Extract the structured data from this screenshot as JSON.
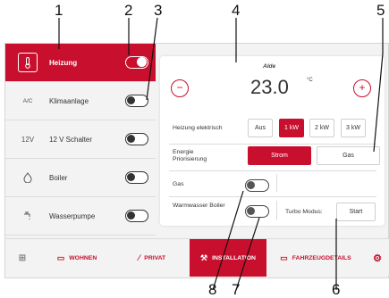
{
  "sidebar": {
    "items": [
      {
        "label": "Heizung",
        "icon": "thermometer-icon",
        "glyph": "🌡",
        "on": true
      },
      {
        "label": "Klimaanlage",
        "icon": "ac-icon",
        "glyph": "A/C",
        "on": false
      },
      {
        "label": "12 V Schalter",
        "icon": "12v-icon",
        "glyph": "12V",
        "on": false
      },
      {
        "label": "Boiler",
        "icon": "flame-icon",
        "glyph": "♨",
        "on": false
      },
      {
        "label": "Wasserpumpe",
        "icon": "faucet-icon",
        "glyph": "⚲",
        "on": false
      }
    ]
  },
  "panel": {
    "brand": "Alde",
    "minus": "−",
    "plus": "+",
    "temperature": "23.0",
    "unit": "°C",
    "heating_label": "Heizung elektrisch",
    "heating_options": [
      "Aus",
      "1 kW",
      "2 kW",
      "3 kW"
    ],
    "heating_selected": "1 kW",
    "energy_label": "Energie Priorisierung",
    "energy_options": [
      "Strom",
      "Gas"
    ],
    "energy_selected": "Strom",
    "gas_label": "Gas",
    "warm_label": "Warmwasser Boiler",
    "turbo_label": "Turbo Modus:",
    "start_label": "Start"
  },
  "nav": {
    "items": [
      {
        "label": "",
        "icon": "grid-icon",
        "glyph": "⊞"
      },
      {
        "label": "WOHNEN",
        "icon": "sofa-icon",
        "glyph": "▭"
      },
      {
        "label": "PRIVAT",
        "icon": "privacy-icon",
        "glyph": "⁄"
      },
      {
        "label": "INSTALLATION",
        "icon": "installation-icon",
        "glyph": "⚒",
        "active": true
      },
      {
        "label": "FAHRZEUGDETAILS",
        "icon": "vehicle-icon",
        "glyph": "▭"
      },
      {
        "label": "",
        "icon": "gear-icon",
        "glyph": "⚙"
      }
    ]
  },
  "callouts": [
    "1",
    "2",
    "3",
    "4",
    "5",
    "6",
    "7",
    "8"
  ],
  "colors": {
    "accent": "#c8102e",
    "background": "#f3f3f3"
  }
}
